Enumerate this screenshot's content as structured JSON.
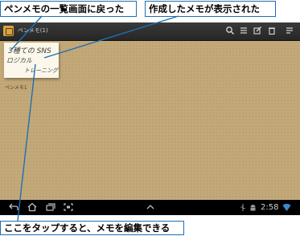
{
  "callouts": {
    "back_to_list": "ペンメモの一覧画面に戻った",
    "memo_created": "作成したメモが表示された",
    "tap_to_edit": "ここをタップすると、メモを編集できる"
  },
  "app": {
    "title": "ペンメモ(1)",
    "icon": "penmemo-app-icon"
  },
  "toolbar": {
    "icons": [
      "search-icon",
      "list-icon",
      "new-memo-icon",
      "delete-icon",
      "menu-icon"
    ]
  },
  "memo": {
    "handwriting_line1": "3種ての SNS",
    "handwriting_line2": "ロジカル",
    "handwriting_line3": "トレーニング",
    "label": "ペンメモ1"
  },
  "navbar": {
    "icons": [
      "back-icon",
      "home-icon",
      "recent-apps-icon",
      "screenshot-icon",
      "up-arrow-icon"
    ],
    "status_icons": [
      "usb-icon",
      "android-icon",
      "wifi-icon"
    ],
    "time": "2:58"
  },
  "colors": {
    "callout_border": "#1f6fb5",
    "background_paper": "#c3a978"
  }
}
